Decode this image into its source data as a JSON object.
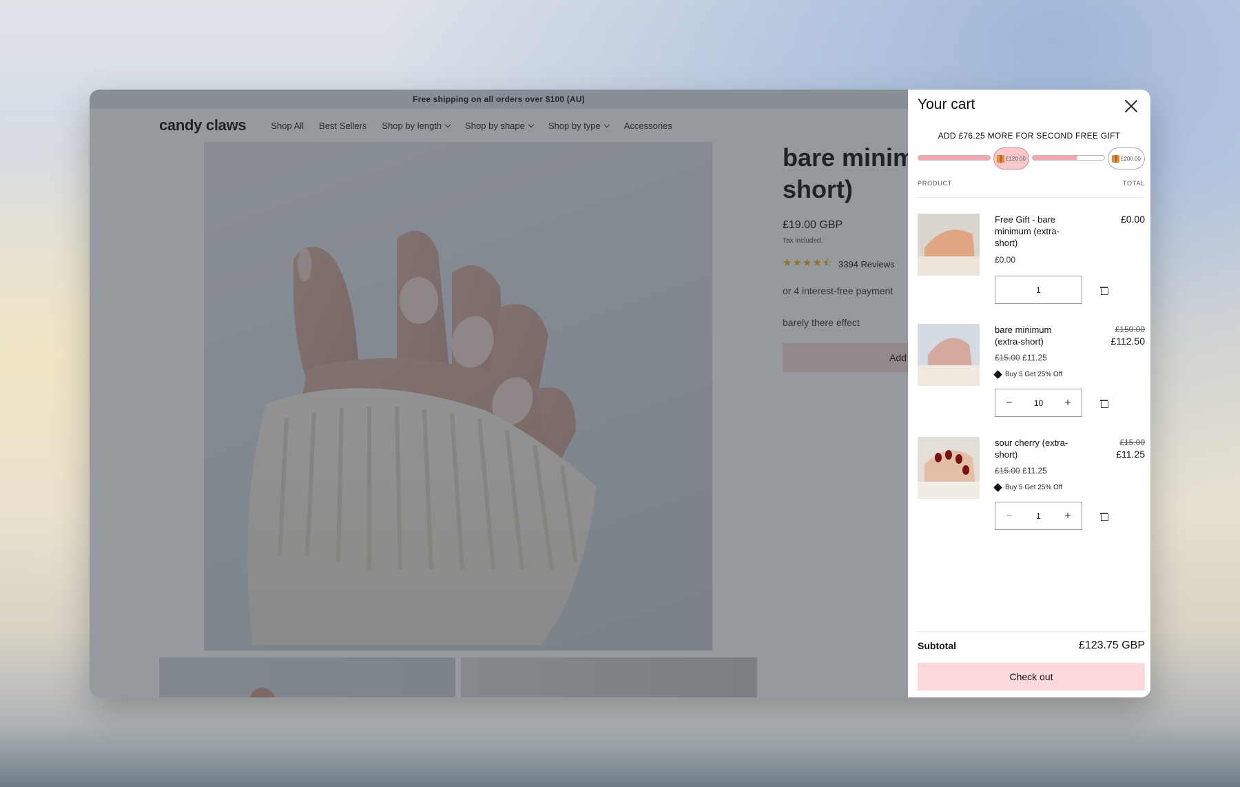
{
  "announcement": "Free shipping on all orders over $100 (AU)",
  "brand": "candy claws",
  "nav": [
    {
      "label": "Shop All",
      "dropdown": false
    },
    {
      "label": "Best Sellers",
      "dropdown": false
    },
    {
      "label": "Shop by length",
      "dropdown": true
    },
    {
      "label": "Shop by shape",
      "dropdown": true
    },
    {
      "label": "Shop by type",
      "dropdown": true
    },
    {
      "label": "Accessories",
      "dropdown": false
    }
  ],
  "product": {
    "title_line1": "bare minim",
    "title_line2": "short)",
    "price": "£19.00 GBP",
    "tax_note": "Tax included.",
    "rating_stars": 4.5,
    "reviews": "3394 Reviews",
    "installments": "or 4 interest-free payment",
    "effect": "barely there effect",
    "add_button": "Add"
  },
  "cart": {
    "title": "Your cart",
    "gift_message": "ADD £76.25 MORE FOR SECOND FREE GIFT",
    "progress": {
      "segment1_fill": 1.0,
      "milestone1": "£120.00",
      "segment2_fill": 0.62,
      "milestone2": "£200.00"
    },
    "col_product": "PRODUCT",
    "col_total": "TOTAL",
    "items": [
      {
        "name": "Free Gift - bare minimum (extra-short)",
        "unit_price": "£0.00",
        "total": "£0.00",
        "qty": "1"
      },
      {
        "name": "bare minimum (extra-short)",
        "unit_original": "£15.00",
        "unit_price": "£11.25",
        "promo": "Buy 5 Get 25% Off",
        "total_original": "£150.00",
        "total": "£112.50",
        "qty": "10"
      },
      {
        "name": "sour cherry (extra-short)",
        "unit_original": "£15.00",
        "unit_price": "£11.25",
        "promo": "Buy 5 Get 25% Off",
        "total_original": "£15.00",
        "total": "£11.25",
        "qty": "1"
      }
    ],
    "subtotal_label": "Subtotal",
    "subtotal": "£123.75 GBP",
    "checkout": "Check out"
  },
  "colors": {
    "accent_pink": "#fdd9db",
    "progress_fill": "#f2a8ad",
    "star": "#f2b400"
  }
}
